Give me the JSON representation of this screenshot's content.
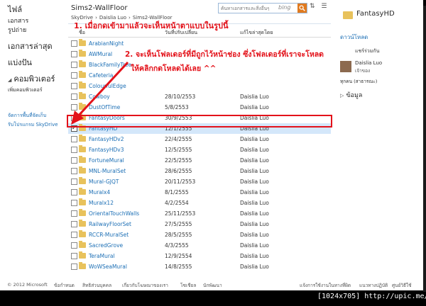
{
  "sidebar": {
    "files": "ไฟล์",
    "documents": "เอกสาร",
    "photos": "รูปถ่าย",
    "recent": "เอกสารล่าสุด",
    "shared": "แบ่งปัน",
    "computers": "คอมพิวเตอร์",
    "add_computer": "เพิ่มคอมพิวเตอร์",
    "manage_storage": "จัดการพื้นที่จัดเก็บ",
    "get_app": "รับโปรแกรม SkyDrive"
  },
  "header": {
    "title": "Sims2-WallFloor",
    "breadcrumb": [
      "SkyDrive",
      "›",
      "Daislia Luo",
      "›",
      "Sims2-WallFloor"
    ],
    "search_placeholder": "ค้นหาเอกสารและสิ่งอื่นๆ",
    "bing": "bing"
  },
  "columns": {
    "name": "ชื่อ",
    "date": "วันที่ปรับเปลี่ยน",
    "owner": "แก้ไขล่าสุดโดย"
  },
  "files": [
    {
      "name": "ArabianNight",
      "date": "",
      "owner": ""
    },
    {
      "name": "AWMural",
      "date": "",
      "owner": ""
    },
    {
      "name": "BlackFamilyTree",
      "date": "",
      "owner": ""
    },
    {
      "name": "Cafeteria",
      "date": "",
      "owner": ""
    },
    {
      "name": "ColourfulEdge",
      "date": "",
      "owner": ""
    },
    {
      "name": "Cowboy",
      "date": "28/10/2553",
      "owner": "Daislia Luo"
    },
    {
      "name": "DustOfTime",
      "date": "5/8/2553",
      "owner": "Daislia Luo"
    },
    {
      "name": "FantasyDoors",
      "date": "30/9/2553",
      "owner": "Daislia Luo"
    },
    {
      "name": "FantasyHD",
      "date": "12/1/2555",
      "owner": "Daislia Luo",
      "selected": true
    },
    {
      "name": "FantasyHDv2",
      "date": "22/4/2555",
      "owner": "Daislia Luo"
    },
    {
      "name": "FantasyHDv3",
      "date": "12/5/2555",
      "owner": "Daislia Luo"
    },
    {
      "name": "FortuneMural",
      "date": "22/5/2555",
      "owner": "Daislia Luo"
    },
    {
      "name": "MNL-MuralSet",
      "date": "28/6/2555",
      "owner": "Daislia Luo"
    },
    {
      "name": "Mural-GJQT",
      "date": "20/11/2553",
      "owner": "Daislia Luo"
    },
    {
      "name": "Muralx4",
      "date": "8/1/2555",
      "owner": "Daislia Luo"
    },
    {
      "name": "Muralx12",
      "date": "4/2/2554",
      "owner": "Daislia Luo"
    },
    {
      "name": "OrientalTouchWalls",
      "date": "25/11/2553",
      "owner": "Daislia Luo"
    },
    {
      "name": "RailwayFloorSet",
      "date": "27/5/2555",
      "owner": "Daislia Luo"
    },
    {
      "name": "RCCR-MuralSet",
      "date": "28/5/2555",
      "owner": "Daislia Luo"
    },
    {
      "name": "SacredGrove",
      "date": "4/3/2555",
      "owner": "Daislia Luo"
    },
    {
      "name": "TeraMural",
      "date": "12/9/2554",
      "owner": "Daislia Luo"
    },
    {
      "name": "WoWSeaMural",
      "date": "14/8/2555",
      "owner": "Daislia Luo"
    }
  ],
  "details": {
    "title": "FantasyHD",
    "download": "ดาวน์โหลด",
    "shared_with": "แชร์ร่วมกัน",
    "owner_name": "Daislia Luo",
    "owner_role": "เจ้าของ",
    "everyone": "ทุกคน (สาธารณะ)",
    "info": "ข้อมูล"
  },
  "footer": {
    "copyright": "© 2012 Microsoft",
    "links": [
      "ข้อกำหนด",
      "สิทธิส่วนบุคคล",
      "เกี่ยวกับโฆษณาของเรา",
      "โซเชียล",
      "นักพัฒนา"
    ],
    "right_links": [
      "แจ้งการใช้งานในทางที่ผิด",
      "แนวทางปฏิบัติ",
      "ศูนย์วิธีใช้"
    ]
  },
  "annotations": {
    "step1": "1. เมื่อกดเข้ามาแล้วจะเห็นหน้าตาแบบในรูปนี้",
    "step2": "2. จะเห็นโฟลเดอร์ที่มีถูกไว้หน้าช่อง ซึ่งโฟลเดอร์ที่เราจะโหลด",
    "step2b": "ให้คลิกกดโหลดได้เลย ^^"
  },
  "watermark": "[1024x705] http://upic.me/",
  "colors": {
    "accent": "#1c6fb5",
    "annotation": "#e3121a",
    "selected_row": "#d4e7fa",
    "folder": "#e8c25c"
  }
}
